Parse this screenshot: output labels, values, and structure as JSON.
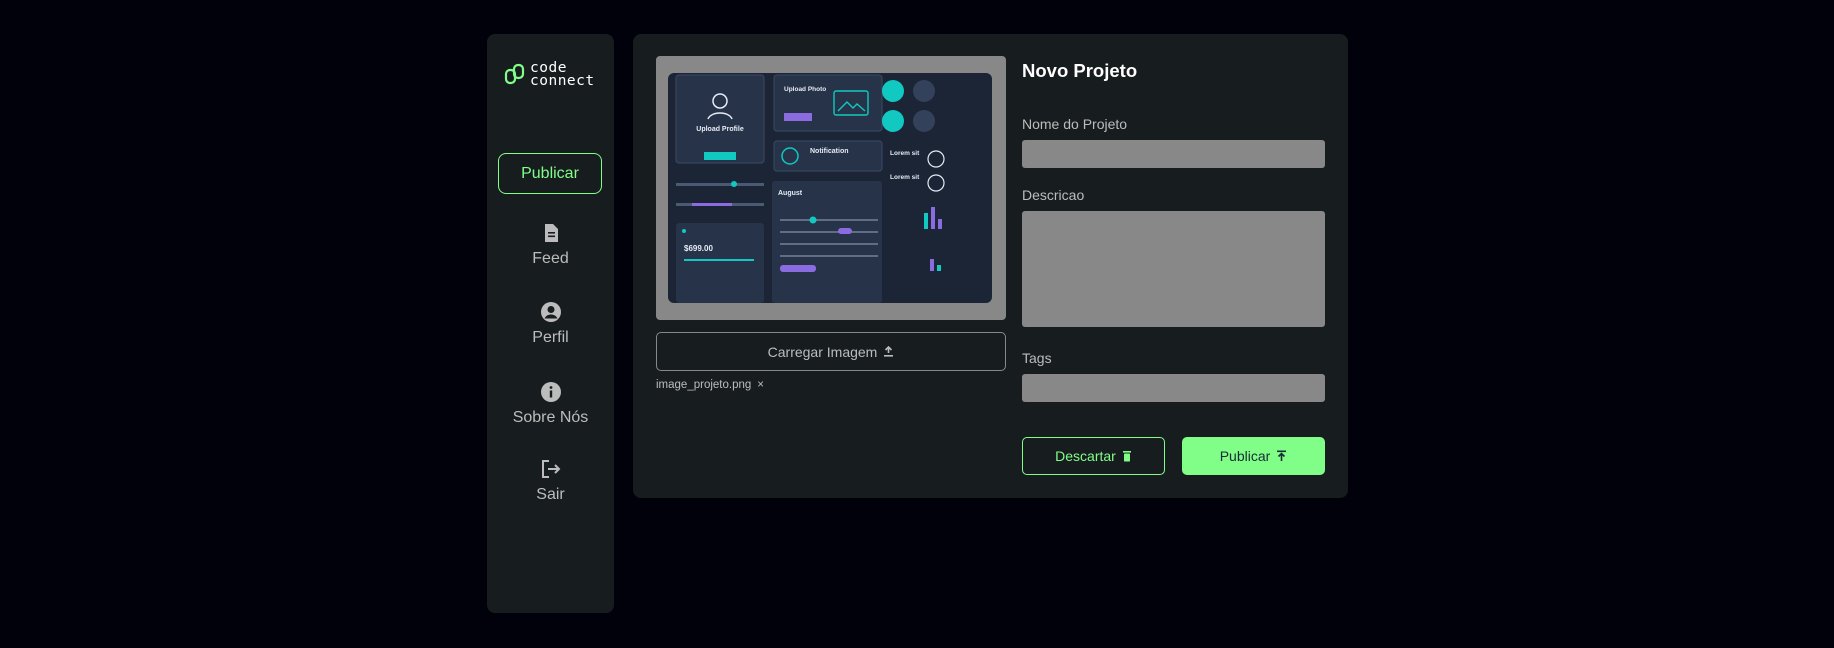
{
  "sidebar": {
    "logo": {
      "line1": "code",
      "line2": "connect"
    },
    "publish_label": "Publicar",
    "items": [
      {
        "label": "Feed",
        "icon": "document-icon"
      },
      {
        "label": "Perfil",
        "icon": "user-circle-icon"
      },
      {
        "label": "Sobre Nós",
        "icon": "info-icon"
      },
      {
        "label": "Sair",
        "icon": "logout-icon"
      }
    ]
  },
  "project": {
    "upload_label": "Carregar Imagem",
    "filename": "image_projeto.png",
    "remove_symbol": "×",
    "preview": {
      "upload_profile": "Upload Profile",
      "upload_photo": "Upload Photo",
      "notification": "Notification",
      "month": "August",
      "price": "$699.00",
      "lorem": "Lorem sit"
    }
  },
  "form": {
    "title": "Novo Projeto",
    "name_label": "Nome do Projeto",
    "name_value": "",
    "description_label": "Descricao",
    "description_value": "",
    "tags_label": "Tags",
    "tags_value": "",
    "discard_label": "Descartar",
    "publish_label": "Publicar"
  },
  "colors": {
    "background": "#01010b",
    "panel": "#171d1f",
    "accent": "#81fe88",
    "field": "#888888",
    "text_muted": "#bcbcbc"
  }
}
